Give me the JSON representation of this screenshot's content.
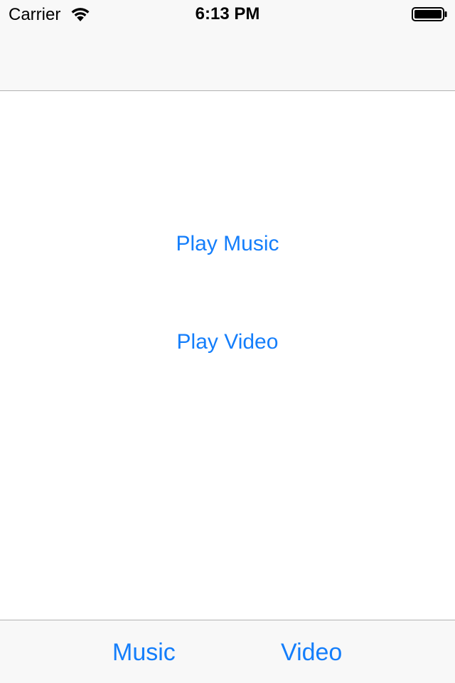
{
  "status_bar": {
    "carrier": "Carrier",
    "time": "6:13 PM",
    "wifi_icon": "wifi-icon",
    "battery_icon": "battery-icon"
  },
  "main": {
    "play_music_label": "Play Music",
    "play_video_label": "Play Video"
  },
  "tab_bar": {
    "items": [
      {
        "label": "Music"
      },
      {
        "label": "Video"
      }
    ]
  },
  "colors": {
    "accent": "#147efb",
    "bar_background": "#f8f8f8",
    "separator": "#b2b2b2"
  }
}
